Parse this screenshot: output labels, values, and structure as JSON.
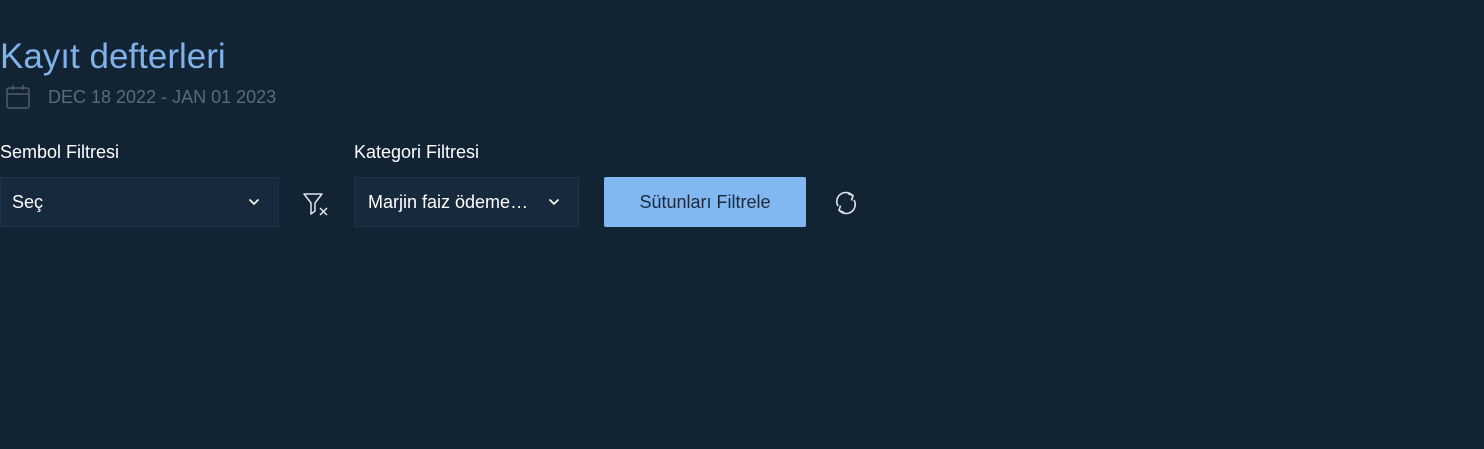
{
  "page": {
    "title": "Kayıt defterleri"
  },
  "date_range": {
    "label": "DEC 18 2022 - JAN 01 2023",
    "icon": "calendar-icon"
  },
  "symbol_filter": {
    "label": "Sembol Filtresi",
    "selected": "Seç",
    "clear_icon": "filter-clear-icon"
  },
  "category_filter": {
    "label": "Kategori Filtresi",
    "selected": "Marjin faiz ödemeleri"
  },
  "actions": {
    "filter_columns_label": "Sütunları Filtrele",
    "refresh_icon": "refresh-icon"
  },
  "colors": {
    "background": "#122333",
    "title": "#7fb2ea",
    "muted_text": "#5d6b78",
    "select_background": "#172a3d",
    "primary_button": "#82b8f2",
    "primary_button_text": "#1b2a3a"
  }
}
